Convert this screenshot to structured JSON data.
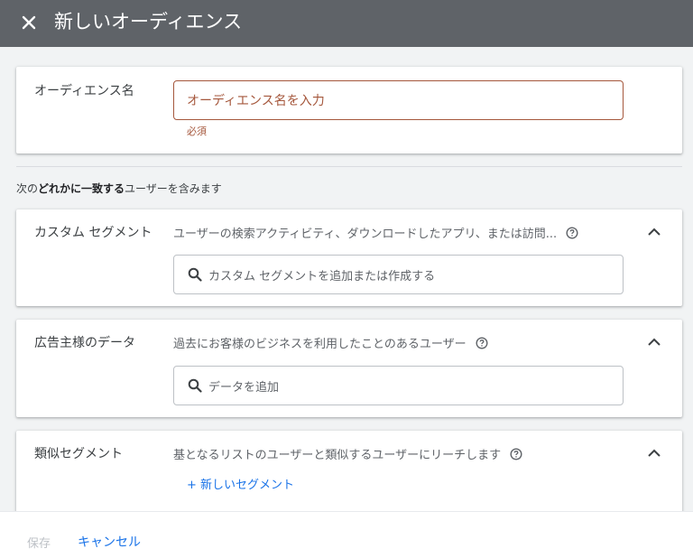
{
  "header": {
    "title": "新しいオーディエンス"
  },
  "audience_name": {
    "label": "オーディエンス名",
    "placeholder": "オーディエンス名を入力",
    "required": "必須"
  },
  "match_text": {
    "prefix": "次の",
    "bold": "どれかに一致する",
    "suffix": "ユーザーを含みます"
  },
  "sections": [
    {
      "label": "カスタム セグメント",
      "description": "ユーザーの検索アクティビティ、ダウンロードしたアプリ、または訪問...",
      "search_placeholder": "カスタム セグメントを追加または作成する"
    },
    {
      "label": "広告主様のデータ",
      "description": "過去にお客様のビジネスを利用したことのあるユーザー",
      "search_placeholder": "データを追加"
    },
    {
      "label": "類似セグメント",
      "description": "基となるリストのユーザーと類似するユーザーにリーチします",
      "link": "+ 新しいセグメント"
    }
  ],
  "footer": {
    "save_label": "保存",
    "cancel_label": "キャンセル"
  },
  "colors": {
    "header_bg": "#5f6368",
    "error": "#a5573c",
    "link": "#1a73e8",
    "page_bg": "#f1f3f4"
  },
  "icons": [
    "close-icon",
    "help-icon",
    "chevron-up-icon",
    "search-icon"
  ]
}
